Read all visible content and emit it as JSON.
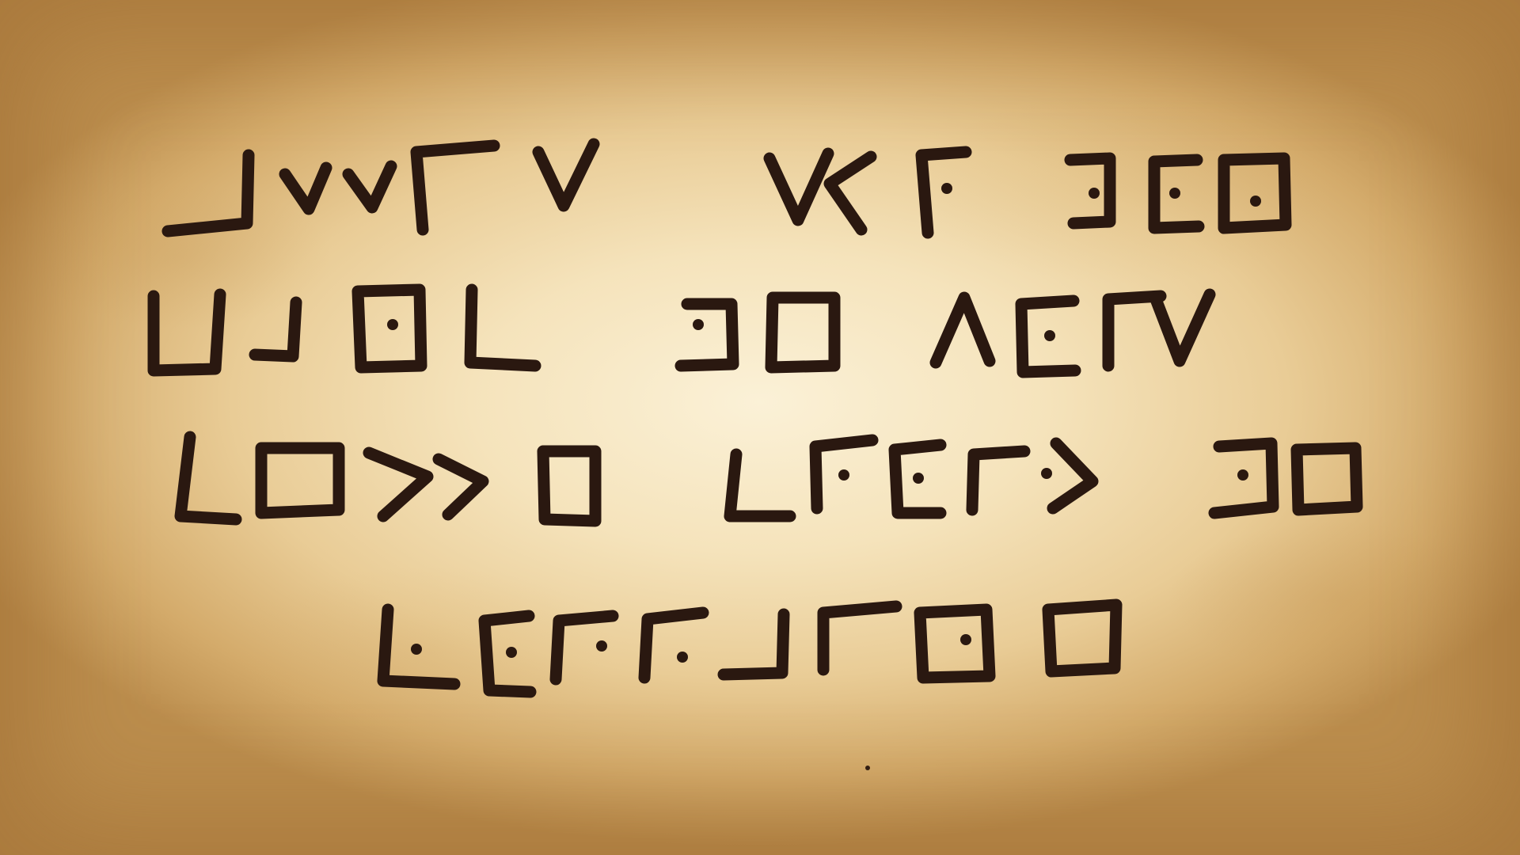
{
  "image": {
    "kind": "handwritten cipher on aged parchment",
    "colors": {
      "ink": "#2a1810",
      "parchment_light": "#fbf1d7",
      "parchment_edge": "#bb8d4d"
    },
    "cipher_lines": [
      {
        "words": 3
      },
      {
        "words": 3
      },
      {
        "words": 3
      },
      {
        "words": 1
      }
    ]
  }
}
